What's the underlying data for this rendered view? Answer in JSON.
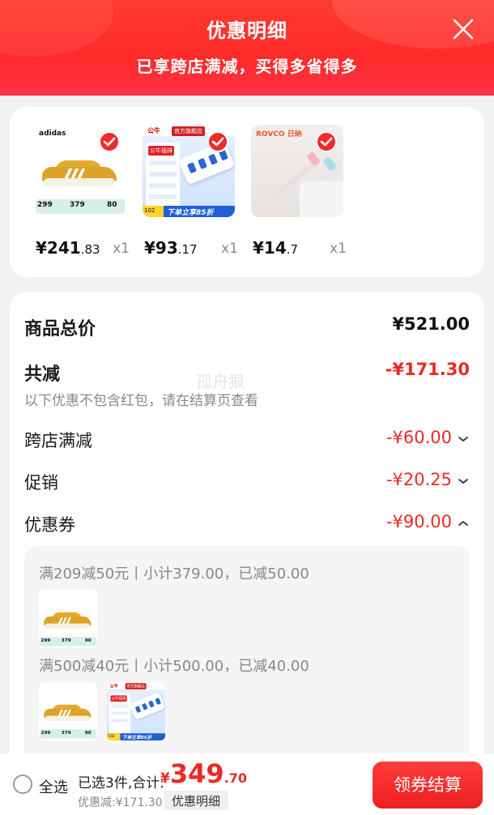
{
  "header": {
    "title": "优惠明细",
    "subtitle": "已享跨店满减，买得多省得多"
  },
  "products": [
    {
      "thumb": "sneaker",
      "price_int": "¥241",
      "price_dec": ".83",
      "qty": "x1"
    },
    {
      "thumb": "power-strip",
      "price_int": "¥93",
      "price_dec": ".17",
      "qty": "x1"
    },
    {
      "thumb": "toothbrush",
      "price_int": "¥14",
      "price_dec": ".7",
      "qty": "x1"
    }
  ],
  "summary": {
    "total_label": "商品总价",
    "total_value": "¥521.00",
    "reduction_label": "共减",
    "reduction_value": "-¥171.30",
    "note": "以下优惠不包含红包，请在结算页查看",
    "watermark": "孤舟狠",
    "rows": [
      {
        "label": "跨店满减",
        "value": "-¥60.00",
        "expanded": false
      },
      {
        "label": "促销",
        "value": "-¥20.25",
        "expanded": false
      },
      {
        "label": "优惠券",
        "value": "-¥90.00",
        "expanded": true
      }
    ]
  },
  "coupons": [
    {
      "text": "满209减50元丨小计379.00，已减50.00",
      "items": [
        "sneaker"
      ]
    },
    {
      "text": "满500减40元丨小计500.00，已减40.00",
      "items": [
        "sneaker",
        "power-strip"
      ]
    }
  ],
  "thumb_text": {
    "shoe_logo": "adidas",
    "shoe_price_a": "299",
    "shoe_price_b": "379",
    "shoe_price_c": "80",
    "ps_brand": "公牛",
    "ps_badge": "官方旗舰店",
    "ps_panel_title": "公牛插排",
    "ps_foot_tag": "102",
    "ps_foot_text": "下单立享85折",
    "tb_logo": "ROVCO 日纳"
  },
  "bottom_bar": {
    "select_all": "全选",
    "selected_text": "已选3件,合计:",
    "total_yen": "¥",
    "total_int": "349",
    "total_dec": ".70",
    "discount_text": "优惠减:¥171.30",
    "detail_tag": "优惠明细",
    "checkout": "领券结算"
  },
  "colors": {
    "accent_red": "#ea2b22",
    "header_red": "#ff2a2a",
    "button_red": "#ec2020"
  }
}
